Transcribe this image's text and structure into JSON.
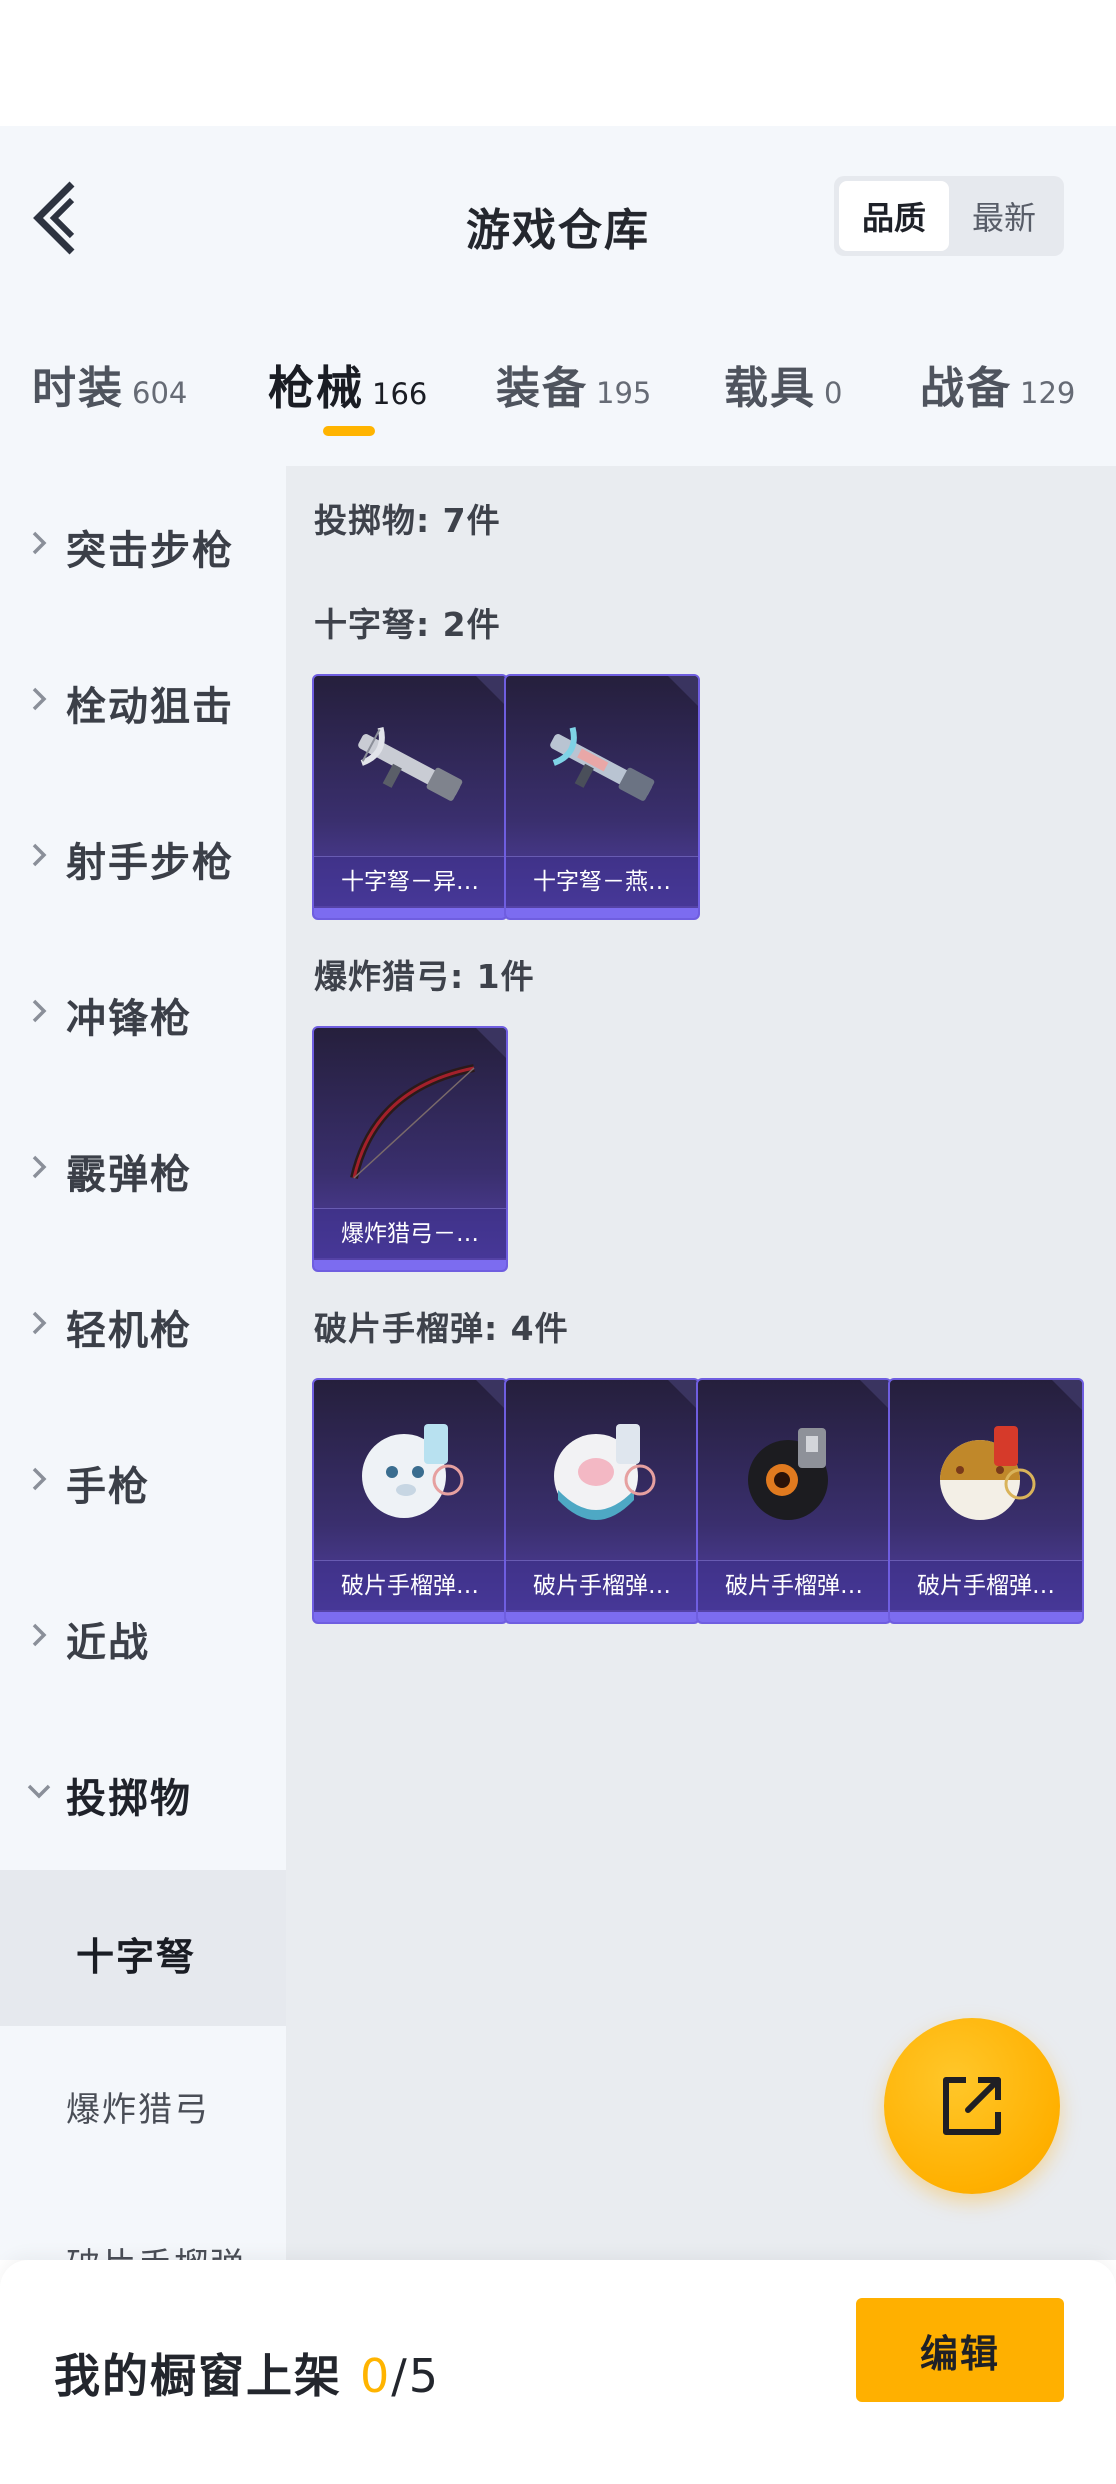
{
  "header": {
    "title": "游戏仓库",
    "sort_options": [
      "品质",
      "最新"
    ],
    "sort_active": "品质"
  },
  "tabs": [
    {
      "label": "时装",
      "count": "604",
      "active": false
    },
    {
      "label": "枪械",
      "count": "166",
      "active": true
    },
    {
      "label": "装备",
      "count": "195",
      "active": false
    },
    {
      "label": "载具",
      "count": "0",
      "active": false
    },
    {
      "label": "战备",
      "count": "129",
      "active": false
    }
  ],
  "sidebar": {
    "categories": [
      "突击步枪",
      "栓动狙击",
      "射手步枪",
      "冲锋枪",
      "霰弹枪",
      "轻机枪",
      "手枪",
      "近战",
      "投掷物"
    ],
    "expanded": "投掷物",
    "subcategories": [
      "十字弩",
      "爆炸猎弓",
      "破片手榴弹"
    ],
    "active_sub": "十字弩"
  },
  "content": {
    "summary": "投掷物: 7件",
    "groups": [
      {
        "title": "十字弩: 2件",
        "items": [
          "十字弩－异…",
          "十字弩－燕…"
        ]
      },
      {
        "title": "爆炸猎弓: 1件",
        "items": [
          "爆炸猎弓－…"
        ]
      },
      {
        "title": "破片手榴弹: 4件",
        "items": [
          "破片手榴弹…",
          "破片手榴弹…",
          "破片手榴弹…",
          "破片手榴弹…"
        ]
      }
    ]
  },
  "icons": {
    "back": "back-arrow-icon",
    "fab": "share-external-icon"
  },
  "colors": {
    "accent": "#ffb400",
    "card_bg": "#3a2f6e",
    "card_border": "#6f5ee0"
  },
  "bottom_bar": {
    "label": "我的橱窗上架",
    "current": "0",
    "total": "/5",
    "edit_label": "编辑"
  }
}
